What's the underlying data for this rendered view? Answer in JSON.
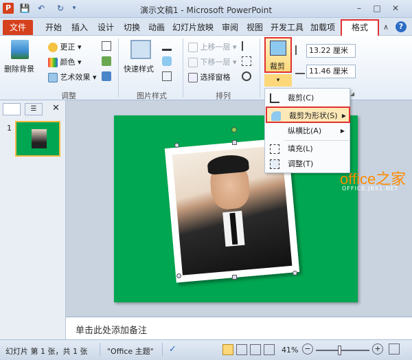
{
  "window": {
    "title": "演示文稿1 - Microsoft PowerPoint"
  },
  "tabs": [
    "文件",
    "开始",
    "插入",
    "设计",
    "切换",
    "动画",
    "幻灯片放映",
    "审阅",
    "视图",
    "开发工具",
    "加载项",
    "格式"
  ],
  "ribbon": {
    "adjust": {
      "remove_bg": "删除背景",
      "corrections": "更正",
      "color": "颜色",
      "artistic": "艺术效果",
      "group_label": "调整"
    },
    "picture_styles": {
      "quick_styles": "快速样式",
      "group_label": "图片样式"
    },
    "arrange": {
      "bring_forward": "上移一层",
      "send_backward": "下移一层",
      "selection_pane": "选择窗格",
      "group_label": "排列"
    },
    "size": {
      "crop": "裁剪",
      "height": "13.22 厘米",
      "width": "11.46 厘米"
    }
  },
  "crop_menu": {
    "items": [
      {
        "label": "裁剪(C)"
      },
      {
        "label": "裁剪为形状(S)"
      },
      {
        "label": "纵横比(A)"
      },
      {
        "label": "填充(L)"
      },
      {
        "label": "调整(T)"
      }
    ]
  },
  "left_pane": {
    "slide_number": "1"
  },
  "notes": {
    "placeholder": "单击此处添加备注"
  },
  "status": {
    "slide_info": "幻灯片 第 1 张，共 1 张",
    "theme": "\"Office 主题\"",
    "zoom": "41%"
  },
  "watermark": {
    "main": "office之家",
    "sub": "OFFICE.JB51.NET"
  },
  "colors": {
    "slide_bg": "#00a651",
    "file_tab": "#d6411d",
    "highlight": "#e03030"
  }
}
